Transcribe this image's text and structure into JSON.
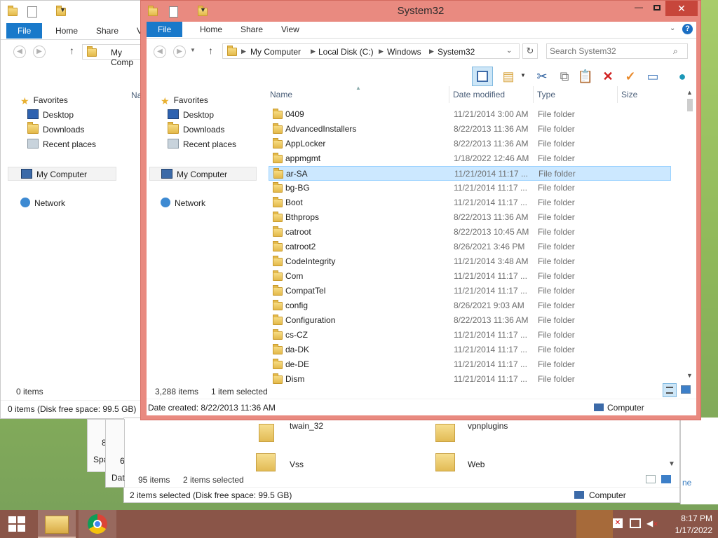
{
  "bg_window": {
    "tabs": [
      "File",
      "Home",
      "Share",
      "V"
    ],
    "address_partial": "My Comp",
    "nav": {
      "favorites": "Favorites",
      "desktop": "Desktop",
      "downloads": "Downloads",
      "recent": "Recent places",
      "computer": "My Computer",
      "network": "Network"
    },
    "col_partial": "Na",
    "items_count": "0 items",
    "status": "0 items (Disk free space: 99.5 GB)"
  },
  "back_window": {
    "partial_labels": [
      "8",
      "Spa",
      "6",
      "Dat"
    ],
    "items": [
      {
        "name": "twain_32"
      },
      {
        "name": "vpnplugins"
      },
      {
        "name": "Vss"
      },
      {
        "name": "Web"
      }
    ],
    "items_count": "95 items",
    "selected": "2 items selected",
    "status": "2 items selected (Disk free space: 99.5 GB)",
    "location": "Computer",
    "edge_partial": "ne"
  },
  "main_window": {
    "title": "System32",
    "tabs": {
      "file": "File",
      "home": "Home",
      "share": "Share",
      "view": "View"
    },
    "breadcrumb": [
      "My Computer",
      "Local Disk (C:)",
      "Windows",
      "System32"
    ],
    "search_placeholder": "Search System32",
    "nav": {
      "favorites": "Favorites",
      "desktop": "Desktop",
      "downloads": "Downloads",
      "recent": "Recent places",
      "computer": "My Computer",
      "network": "Network"
    },
    "columns": {
      "name": "Name",
      "date": "Date modified",
      "type": "Type",
      "size": "Size"
    },
    "files": [
      {
        "name": "0409",
        "date": "11/21/2014 3:00 AM",
        "type": "File folder"
      },
      {
        "name": "AdvancedInstallers",
        "date": "8/22/2013 11:36 AM",
        "type": "File folder"
      },
      {
        "name": "AppLocker",
        "date": "8/22/2013 11:36 AM",
        "type": "File folder"
      },
      {
        "name": "appmgmt",
        "date": "1/18/2022 12:46 AM",
        "type": "File folder"
      },
      {
        "name": "ar-SA",
        "date": "11/21/2014 11:17 ...",
        "type": "File folder",
        "selected": true
      },
      {
        "name": "bg-BG",
        "date": "11/21/2014 11:17 ...",
        "type": "File folder"
      },
      {
        "name": "Boot",
        "date": "11/21/2014 11:17 ...",
        "type": "File folder"
      },
      {
        "name": "Bthprops",
        "date": "8/22/2013 11:36 AM",
        "type": "File folder"
      },
      {
        "name": "catroot",
        "date": "8/22/2013 10:45 AM",
        "type": "File folder"
      },
      {
        "name": "catroot2",
        "date": "8/26/2021 3:46 PM",
        "type": "File folder"
      },
      {
        "name": "CodeIntegrity",
        "date": "11/21/2014 3:48 AM",
        "type": "File folder"
      },
      {
        "name": "Com",
        "date": "11/21/2014 11:17 ...",
        "type": "File folder"
      },
      {
        "name": "CompatTel",
        "date": "11/21/2014 11:17 ...",
        "type": "File folder"
      },
      {
        "name": "config",
        "date": "8/26/2021 9:03 AM",
        "type": "File folder"
      },
      {
        "name": "Configuration",
        "date": "8/22/2013 11:36 AM",
        "type": "File folder"
      },
      {
        "name": "cs-CZ",
        "date": "11/21/2014 11:17 ...",
        "type": "File folder"
      },
      {
        "name": "da-DK",
        "date": "11/21/2014 11:17 ...",
        "type": "File folder"
      },
      {
        "name": "de-DE",
        "date": "11/21/2014 11:17 ...",
        "type": "File folder"
      },
      {
        "name": "Dism",
        "date": "11/21/2014 11:17 ...",
        "type": "File folder"
      }
    ],
    "items_count": "3,288 items",
    "selected": "1 item selected",
    "status": "Date created: 8/22/2013 11:36 AM",
    "location": "Computer"
  },
  "taskbar": {
    "time": "8:17 PM",
    "date": "1/17/2022"
  },
  "colors": {
    "accent": "#1979ca",
    "title_bar": "#e98a80",
    "selection": "#cce8ff",
    "taskbar": "#8a5548"
  },
  "icons": [
    "folder-icon",
    "star-icon",
    "desktop-icon",
    "computer-icon",
    "network-icon",
    "search-icon",
    "refresh-icon",
    "cut-icon",
    "copy-icon",
    "paste-icon",
    "delete-icon",
    "rename-icon",
    "properties-icon",
    "help-icon",
    "windows-icon",
    "explorer-icon",
    "chrome-icon"
  ]
}
